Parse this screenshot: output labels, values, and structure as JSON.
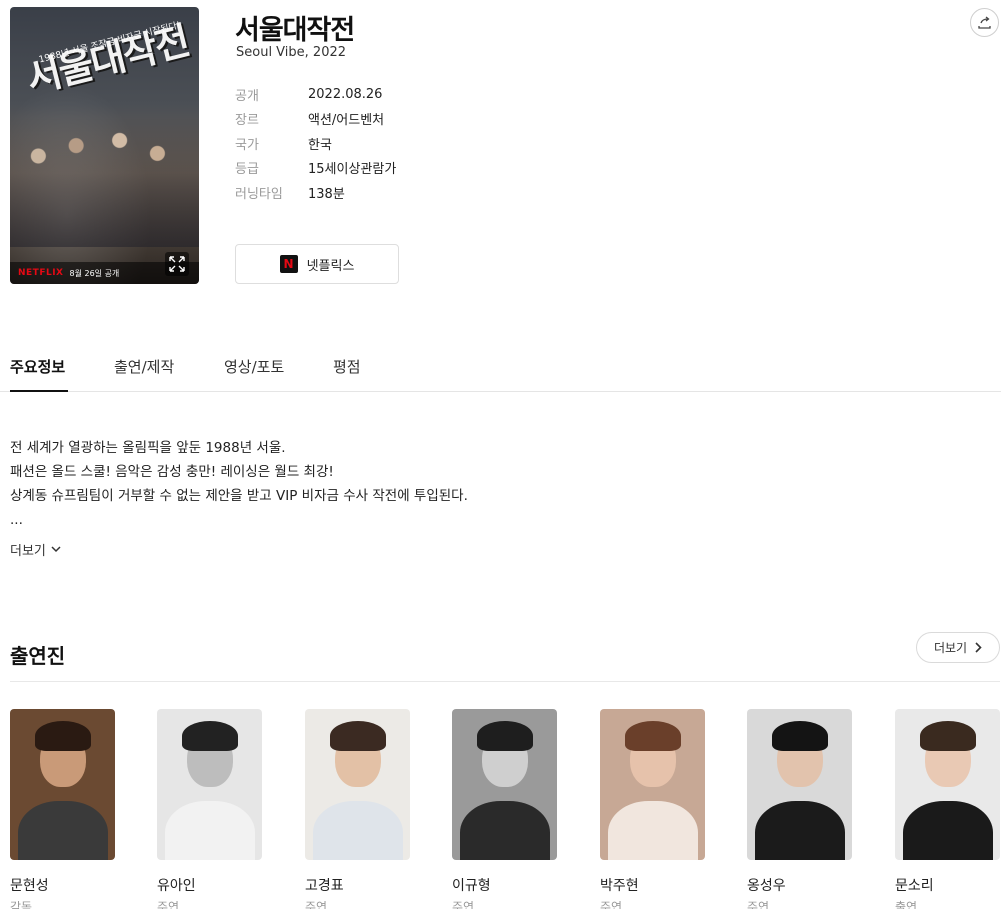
{
  "movie": {
    "title": "서울대작전",
    "subtitle": "Seoul Vibe, 2022",
    "poster": {
      "title": "서울대작전",
      "tagline": "1988년 서울 조작금 비자금 시작된다!",
      "brand": "NETFLIX",
      "date": "8월 26일 공개"
    },
    "meta": [
      {
        "label": "공개",
        "value": "2022.08.26"
      },
      {
        "label": "장르",
        "value": "액션/어드벤처"
      },
      {
        "label": "국가",
        "value": "한국"
      },
      {
        "label": "등급",
        "value": "15세이상관람가"
      },
      {
        "label": "러닝타임",
        "value": "138분"
      }
    ],
    "stream_button": {
      "logo": "N",
      "label": "넷플릭스"
    }
  },
  "tabs": [
    {
      "label": "주요정보",
      "active": true
    },
    {
      "label": "출연/제작",
      "active": false
    },
    {
      "label": "영상/포토",
      "active": false
    },
    {
      "label": "평점",
      "active": false
    }
  ],
  "synopsis": {
    "lines": [
      "전 세계가 열광하는 올림픽을 앞둔 1988년 서울.",
      "패션은 올드 스쿨! 음악은 감성 충만! 레이싱은 월드 최강!",
      "상계동 슈프림팀이 거부할 수 없는 제안을 받고 VIP 비자금 수사 작전에 투입된다.",
      "..."
    ],
    "more_label": "더보기"
  },
  "cast": {
    "title": "출연진",
    "more_label": "더보기",
    "members": [
      {
        "name": "문현성",
        "role": "감독",
        "bg": "#6b4a32",
        "skin": "#c99a78",
        "hair": "#2a1a12",
        "cloth": "#3a3a3a"
      },
      {
        "name": "유아인",
        "role": "주연",
        "bg": "#e6e6e6",
        "skin": "#bdbdbd",
        "hair": "#222222",
        "cloth": "#f2f2f2"
      },
      {
        "name": "고경표",
        "role": "주연",
        "bg": "#eceae6",
        "skin": "#e3c1a6",
        "hair": "#3b2a22",
        "cloth": "#dfe4ea"
      },
      {
        "name": "이규형",
        "role": "주연",
        "bg": "#9a9a9a",
        "skin": "#cfcfcf",
        "hair": "#1e1e1e",
        "cloth": "#2a2a2a"
      },
      {
        "name": "박주현",
        "role": "주연",
        "bg": "#c7a895",
        "skin": "#e6c2ab",
        "hair": "#6a3f2a",
        "cloth": "#f1e6de"
      },
      {
        "name": "옹성우",
        "role": "주연",
        "bg": "#d9d9d9",
        "skin": "#e2c3ad",
        "hair": "#141414",
        "cloth": "#1b1b1b"
      },
      {
        "name": "문소리",
        "role": "출연",
        "bg": "#e9e9e9",
        "skin": "#e9c9b4",
        "hair": "#3a2a1f",
        "cloth": "#1a1a1a"
      }
    ]
  },
  "colors": {
    "accent": "#e50914",
    "text": "#222222",
    "muted": "#999999"
  }
}
